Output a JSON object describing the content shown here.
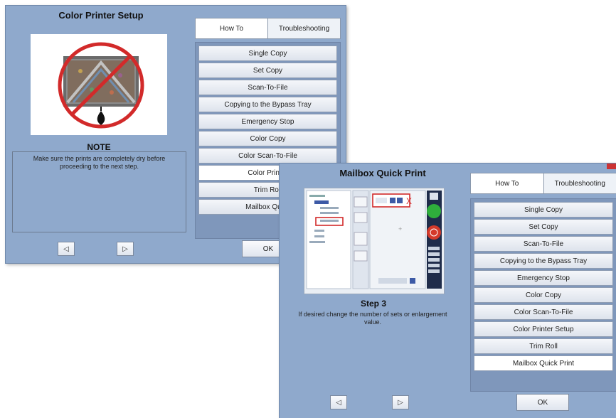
{
  "left_window": {
    "title": "Color Printer Setup",
    "step_heading": "NOTE",
    "instruction": "Make sure the prints are completely dry before proceeding to the next step.",
    "tabs": [
      {
        "label": "How To",
        "active": true
      },
      {
        "label": "Troubleshooting",
        "active": false
      }
    ],
    "list_items": [
      "Single Copy",
      "Set Copy",
      "Scan-To-File",
      "Copying to the Bypass Tray",
      "Emergency Stop",
      "Color Copy",
      "Color Scan-To-File",
      "Color Printer",
      "Trim Roll",
      "Mailbox Quick"
    ],
    "selected_index": 7,
    "ok_label": "OK",
    "prev_icon": "◁",
    "next_icon": "▷"
  },
  "right_window": {
    "title": "Mailbox Quick Print",
    "step_heading": "Step 3",
    "instruction": "If desired change the number of sets or enlargement value.",
    "tabs": [
      {
        "label": "How To",
        "active": true
      },
      {
        "label": "Troubleshooting",
        "active": false
      }
    ],
    "list_items": [
      "Single Copy",
      "Set Copy",
      "Scan-To-File",
      "Copying to the Bypass Tray",
      "Emergency Stop",
      "Color Copy",
      "Color Scan-To-File",
      "Color Printer Setup",
      "Trim Roll",
      "Mailbox Quick Print"
    ],
    "selected_index": 9,
    "ok_label": "OK",
    "prev_icon": "◁",
    "next_icon": "▷"
  },
  "colors": {
    "window_bg": "#8fa9cc",
    "panel_bg": "#7f97bb",
    "no_symbol": "#d22a2a",
    "go_button": "#2fae3c",
    "stop_button": "#d43a2a"
  }
}
